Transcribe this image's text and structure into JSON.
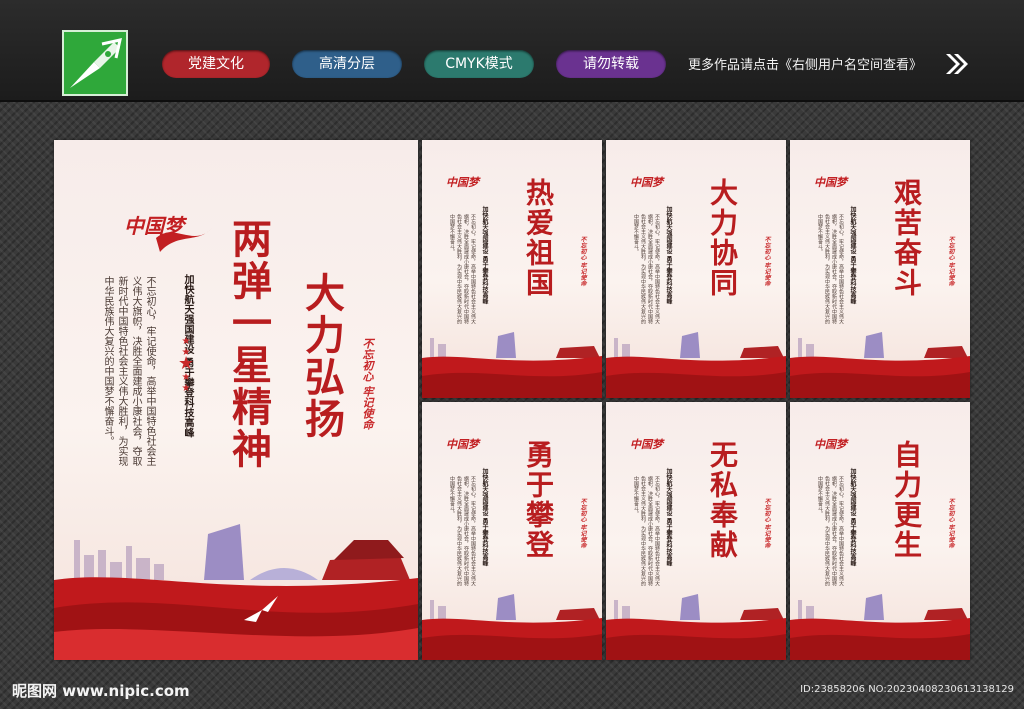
{
  "header": {
    "tags": [
      "党建文化",
      "高清分层",
      "CMYK模式",
      "请勿转载"
    ],
    "tag_colors": [
      "#b0262c",
      "#2f5f8a",
      "#2c7a6e",
      "#6a3290"
    ],
    "info": "更多作品请点击《右侧用户名空间查看》"
  },
  "main_poster": {
    "title_col1": "两弹一星精神",
    "title_col2": "大力弘扬",
    "heading": "加快航天强国建设 勇于攀登科技高峰",
    "body": "不忘初心，牢记使命，高举中国特色社会主义伟大旗帜，决胜全面建成小康社会，夺取新时代中国特色社会主义伟大胜利，为实现中华民族伟大复兴的中国梦不懈奋斗。",
    "seal": "不忘初心 牢记使命",
    "brand": "中国梦"
  },
  "small_posters": [
    {
      "title": "热爱祖国"
    },
    {
      "title": "大力协同"
    },
    {
      "title": "艰苦奋斗"
    },
    {
      "title": "勇于攀登"
    },
    {
      "title": "无私奉献"
    },
    {
      "title": "自力更生"
    }
  ],
  "footer": {
    "site": "昵图网 www.nipic.com",
    "id": "ID:23858206 NO:20230408230613138129"
  },
  "colors": {
    "red": "#b81d1f",
    "dark_bg": "#3a3a3a",
    "logo_green": "#2fa83a"
  }
}
